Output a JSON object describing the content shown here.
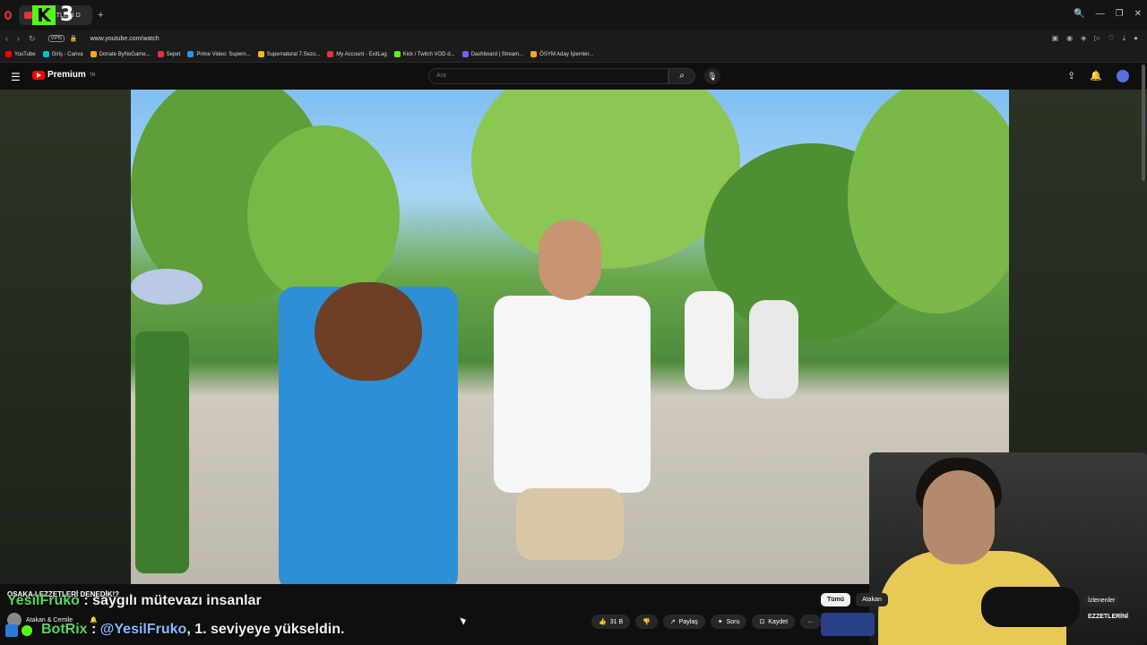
{
  "browser": {
    "tab_title": "LEZZETLERİ D",
    "kick_badge": "K",
    "kick_number": "3",
    "url": "www.youtube.com/watch",
    "vpn": "VPN",
    "window_controls": [
      "🔍",
      "—",
      "❐",
      "✕"
    ],
    "bookmarks": [
      {
        "label": "YouTube",
        "color": "#ff0000"
      },
      {
        "label": "Giriş - Canva",
        "color": "#00c4cc"
      },
      {
        "label": "Donate ByNoGame...",
        "color": "#f5a623"
      },
      {
        "label": "Sepet",
        "color": "#e0353b"
      },
      {
        "label": "Prime Video: Supern...",
        "color": "#1a98ff"
      },
      {
        "label": "Supernatural 7.Sezo...",
        "color": "#f0c000"
      },
      {
        "label": "My Account - ExitLag",
        "color": "#e0353b"
      },
      {
        "label": "Kick / Twitch VOD d...",
        "color": "#53fc18"
      },
      {
        "label": "Dashboard | Stream...",
        "color": "#7a5cff"
      },
      {
        "label": "ÖSYM Aday İşlemler...",
        "color": "#f5a623"
      }
    ]
  },
  "youtube": {
    "logo_text": "Premium",
    "logo_region": "TR",
    "search_placeholder": "Ara",
    "video_title": "OSAKA LEZZETLERİ DENEDİK!?",
    "channel_name": "Atakan & Cemile",
    "actions": {
      "likes": "31 B",
      "share": "Paylaş",
      "ask": "Soru",
      "save": "Kaydet",
      "more": "···"
    },
    "chips": [
      "Tümü",
      "Atakan"
    ],
    "chip_right": "İzlenenler",
    "suggest_text": "EZZETLERİNİ"
  },
  "chat_overlay": [
    {
      "user": "YesilFruko",
      "sep": " : ",
      "message": "saygılı mütevazı insanlar"
    },
    {
      "user": "BotRix",
      "sep": " : ",
      "mention": "@YesilFruko",
      "message": ", 1. seviyeye yükseldin."
    }
  ]
}
